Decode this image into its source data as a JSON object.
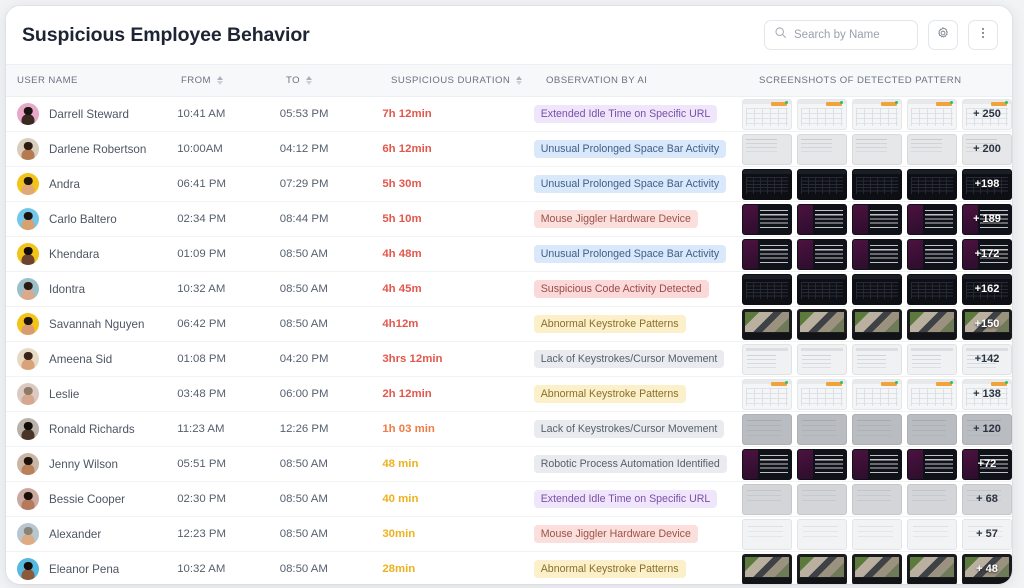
{
  "header": {
    "title": "Suspicious Employee Behavior",
    "search_placeholder": "Search by Name",
    "search_value": "",
    "settings_label": "Settings",
    "more_label": "More options"
  },
  "table": {
    "columns": [
      {
        "key": "user",
        "label": "USER NAME",
        "sortable": false
      },
      {
        "key": "from",
        "label": "FROM",
        "sortable": true
      },
      {
        "key": "to",
        "label": "TO",
        "sortable": true
      },
      {
        "key": "dur",
        "label": "SUSPICIOUS DURATION",
        "sortable": true
      },
      {
        "key": "obs",
        "label": "OBSERVATION BY AI",
        "sortable": false
      },
      {
        "key": "shots",
        "label": "SCREENSHOTS OF DETECTED PATTERN",
        "sortable": false
      }
    ],
    "chip_styles": {
      "purple": {
        "bg": "#f0e6fb",
        "fg": "#7a4fa6"
      },
      "blue": {
        "bg": "#d9e8fb",
        "fg": "#3f5f86"
      },
      "pink": {
        "bg": "#fbdfdc",
        "fg": "#9c5248"
      },
      "red": {
        "bg": "#fbd9d9",
        "fg": "#9a4b4b"
      },
      "yellow": {
        "bg": "#fbf0c9",
        "fg": "#8a6f2a"
      },
      "grey": {
        "bg": "#e9ebee",
        "fg": "#56606e"
      }
    },
    "duration_colors": {
      "red": "#e2574c",
      "orange": "#ef7b45",
      "amber": "#edb11f"
    },
    "rows": [
      {
        "name": "Darrell Steward",
        "from": "10:41 AM",
        "to": "05:53 PM",
        "duration": "7h 12min",
        "duration_tone": "red",
        "observation": "Extended Idle Time on Specific URL",
        "chip": "purple",
        "avatar": {
          "ring": "#e8a8c8",
          "skin": "#3b2a22",
          "hair": "#1b1411"
        },
        "thumb_style": "t-sheet",
        "more_count": "+ 250"
      },
      {
        "name": "Darlene Robertson",
        "from": "10:00AM",
        "to": "04:12 PM",
        "duration": "6h 12min",
        "duration_tone": "red",
        "observation": "Unusual Prolonged Space Bar Activity",
        "chip": "blue",
        "avatar": {
          "ring": "#d9cdbc",
          "skin": "#b57a52",
          "hair": "#2b1c14"
        },
        "thumb_style": "t-light",
        "more_count": "+ 200"
      },
      {
        "name": "Andra",
        "from": "06:41 PM",
        "to": "07:29 PM",
        "duration": "5h 30m",
        "duration_tone": "red",
        "observation": "Unusual Prolonged Space Bar Activity",
        "chip": "blue",
        "avatar": {
          "ring": "#f2c319",
          "skin": "#e0a878",
          "hair": "#241611"
        },
        "thumb_style": "t-dark",
        "more_count": "+198"
      },
      {
        "name": "Carlo Baltero",
        "from": "02:34 PM",
        "to": "08:44 PM",
        "duration": "5h 10m",
        "duration_tone": "red",
        "observation": "Mouse Jiggler Hardware Device",
        "chip": "pink",
        "avatar": {
          "ring": "#74c7e8",
          "skin": "#d9a070",
          "hair": "#1c1410"
        },
        "thumb_style": "t-purple",
        "more_count": "+ 189"
      },
      {
        "name": "Khendara",
        "from": "01:09 PM",
        "to": "08:50 AM",
        "duration": "4h 48m",
        "duration_tone": "red",
        "observation": "Unusual Prolonged Space Bar Activity",
        "chip": "blue",
        "avatar": {
          "ring": "#f2c319",
          "skin": "#6b4430",
          "hair": "#130d0a"
        },
        "thumb_style": "t-purple",
        "more_count": "+172"
      },
      {
        "name": "Idontra",
        "from": "10:32 AM",
        "to": "08:50 AM",
        "duration": "4h 45m",
        "duration_tone": "red",
        "observation": "Suspicious Code Activity Detected",
        "chip": "red",
        "avatar": {
          "ring": "#9bc0c7",
          "skin": "#dba98b",
          "hair": "#2a1b14"
        },
        "thumb_style": "t-dark",
        "more_count": "+162"
      },
      {
        "name": "Savannah Nguyen",
        "from": "06:42 PM",
        "to": "08:50 AM",
        "duration": "4h12m",
        "duration_tone": "red",
        "observation": "Abnormal Keystroke Patterns",
        "chip": "yellow",
        "avatar": {
          "ring": "#f2c319",
          "skin": "#d99b72",
          "hair": "#22150f"
        },
        "thumb_style": "t-video",
        "more_count": "+150"
      },
      {
        "name": "Ameena Sid",
        "from": "01:08 PM",
        "to": "04:20 PM",
        "duration": "3hrs 12min",
        "duration_tone": "red",
        "observation": "Lack of Keystrokes/Cursor Movement",
        "chip": "grey",
        "avatar": {
          "ring": "#e8d9c4",
          "skin": "#d9a278",
          "hair": "#3a2418"
        },
        "thumb_style": "t-doc",
        "more_count": "+142"
      },
      {
        "name": "Leslie",
        "from": "03:48 PM",
        "to": "06:00 PM",
        "duration": "2h 12min",
        "duration_tone": "red",
        "observation": "Abnormal Keystroke Patterns",
        "chip": "yellow",
        "avatar": {
          "ring": "#dcc9c2",
          "skin": "#d6a98f",
          "hair": "#8d7a67"
        },
        "thumb_style": "t-sheet",
        "more_count": "+ 138"
      },
      {
        "name": "Ronald Richards",
        "from": "11:23 AM",
        "to": "12:26 PM",
        "duration": "1h 03 min",
        "duration_tone": "orange",
        "observation": "Lack of Keystrokes/Cursor Movement",
        "chip": "grey",
        "avatar": {
          "ring": "#b9b2a8",
          "skin": "#4a3428",
          "hair": "#120c09"
        },
        "thumb_style": "t-grey",
        "more_count": "+ 120"
      },
      {
        "name": "Jenny Wilson",
        "from": "05:51 PM",
        "to": "08:50 AM",
        "duration": "48 min",
        "duration_tone": "amber",
        "observation": "Robotic Process Automation Identified",
        "chip": "grey",
        "avatar": {
          "ring": "#c9b6a4",
          "skin": "#b9805a",
          "hair": "#1d120c"
        },
        "thumb_style": "t-purple",
        "more_count": "+72"
      },
      {
        "name": "Bessie Cooper",
        "from": "02:30 PM",
        "to": "08:50 AM",
        "duration": "40 min",
        "duration_tone": "amber",
        "observation": "Extended Idle Time on Specific URL",
        "chip": "purple",
        "avatar": {
          "ring": "#caa9a0",
          "skin": "#b57a5c",
          "hair": "#1a1009"
        },
        "thumb_style": "t-greylt",
        "more_count": "+ 68"
      },
      {
        "name": "Alexander",
        "from": "12:23 PM",
        "to": "08:50 AM",
        "duration": "30min",
        "duration_tone": "amber",
        "observation": "Mouse Jiggler Hardware Device",
        "chip": "pink",
        "avatar": {
          "ring": "#b8c6cf",
          "skin": "#ddac85",
          "hair": "#8a8378"
        },
        "thumb_style": "t-plain",
        "more_count": "+ 57"
      },
      {
        "name": "Eleanor Pena",
        "from": "10:32 AM",
        "to": "08:50 AM",
        "duration": "28min",
        "duration_tone": "amber",
        "observation": "Abnormal Keystroke Patterns",
        "chip": "yellow",
        "avatar": {
          "ring": "#57b9e0",
          "skin": "#8a5a3a",
          "hair": "#140d08"
        },
        "thumb_style": "t-video",
        "more_count": "+ 48"
      }
    ]
  }
}
